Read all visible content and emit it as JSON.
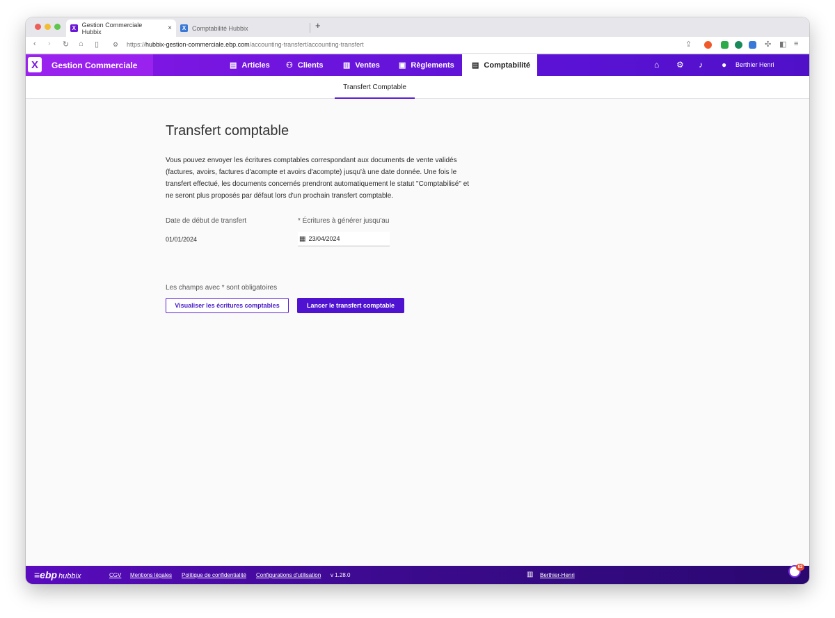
{
  "browser": {
    "tabs": [
      {
        "title": "Gestion Commerciale Hubbix",
        "favicon": "X",
        "active": true
      },
      {
        "title": "Comptabilité Hubbix",
        "favicon": "X",
        "active": false
      }
    ],
    "close_glyph": "×",
    "new_tab_glyph": "+",
    "url_scheme": "https://",
    "url_host": "hubbix-gestion-commerciale.ebp.com",
    "url_path": "/accounting-transfert/accounting-transfert"
  },
  "app": {
    "logo_letter": "X",
    "title": "Gestion Commerciale",
    "menu": [
      {
        "label": "Articles",
        "icon": "archive-icon",
        "glyph": "▤"
      },
      {
        "label": "Clients",
        "icon": "group-icon",
        "glyph": "⚇"
      },
      {
        "label": "Ventes",
        "icon": "document-icon",
        "glyph": "▥"
      },
      {
        "label": "Règlements",
        "icon": "wallet-icon",
        "glyph": "▣"
      },
      {
        "label": "Comptabilité",
        "icon": "ledger-icon",
        "glyph": "▤"
      }
    ],
    "user_name": "Berthier Henri"
  },
  "subnav": {
    "tab": "Transfert Comptable"
  },
  "page": {
    "title": "Transfert comptable",
    "description": "Vous pouvez envoyer les écritures comptables correspondant aux documents de vente validés (factures, avoirs, factures d'acompte et avoirs d'acompte) jusqu'à une date donnée. Une fois le transfert effectué, les documents concernés prendront automatiquement le statut \"Comptabilisé\" et ne seront plus proposés par défaut lors d'un prochain transfert comptable.",
    "start_label": "Date de début de transfert",
    "start_value": "01/01/2024",
    "end_label": "* Écritures à générer jusqu'au",
    "end_value": "23/04/2024",
    "required_note": "Les champs avec * sont obligatoires",
    "btn_preview": "Visualiser les écritures comptables",
    "btn_launch": "Lancer le transfert comptable"
  },
  "footer": {
    "brand": "≡ebp",
    "brand_sub": "hubbix",
    "links": [
      "CGV",
      "Mentions légales",
      "Politique de confidentialité",
      "Configurations d'utilisation"
    ],
    "version": "v 1.28.0",
    "company": "Berthier-Henri",
    "chat_badge": "63"
  },
  "colors": {
    "brand_purple": "#6a14dc",
    "primary_button": "#4e12d0",
    "footer": "#3c0a8f"
  }
}
